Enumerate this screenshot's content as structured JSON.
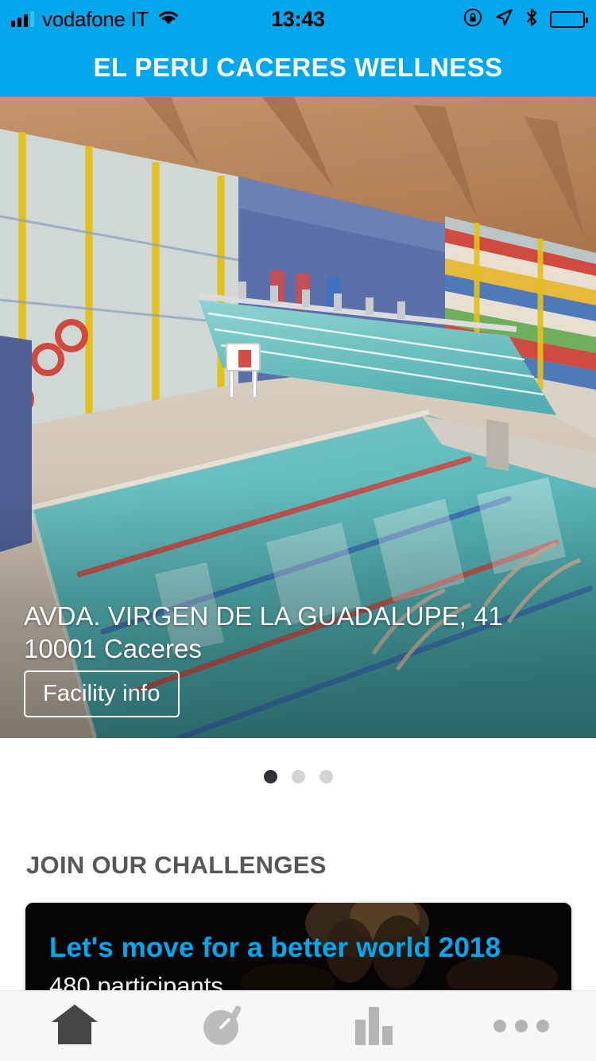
{
  "status_bar": {
    "carrier": "vodafone IT",
    "time": "13:43",
    "signal_icon": "cellular-signal-icon",
    "wifi_icon": "wifi-icon",
    "rotation_lock_icon": "rotation-lock-icon",
    "location_icon": "location-arrow-icon",
    "bluetooth_icon": "bluetooth-icon",
    "battery_icon": "battery-icon"
  },
  "header": {
    "title": "EL PERU CACERES WELLNESS",
    "background_color": "#01a7ea",
    "text_color": "#ffffff"
  },
  "hero": {
    "image_name": "indoor-swimming-pool-photo",
    "address_line1": "AVDA. VIRGEN DE LA GUADALUPE, 41",
    "address_line2": " 10001 Caceres",
    "facility_button_label": "Facility info"
  },
  "carousel": {
    "total": 3,
    "active_index": 0,
    "active_color": "#2b3338",
    "inactive_color": "#d2d3d4"
  },
  "challenges": {
    "section_title": "JOIN OUR CHALLENGES",
    "cards": [
      {
        "title": "Let's move for a better world 2018",
        "subtitle": "480 participants",
        "title_color": "#01a8f0",
        "image_name": "challenge-runner-photo"
      }
    ]
  },
  "tab_bar": {
    "items": [
      {
        "name": "home",
        "icon": "home-icon",
        "active": true
      },
      {
        "name": "activity",
        "icon": "stopwatch-icon",
        "active": false
      },
      {
        "name": "statistics",
        "icon": "bar-chart-icon",
        "active": false
      },
      {
        "name": "more",
        "icon": "ellipsis-icon",
        "active": false
      }
    ],
    "active_color": "#444648",
    "inactive_color": "#b3b3b3"
  }
}
